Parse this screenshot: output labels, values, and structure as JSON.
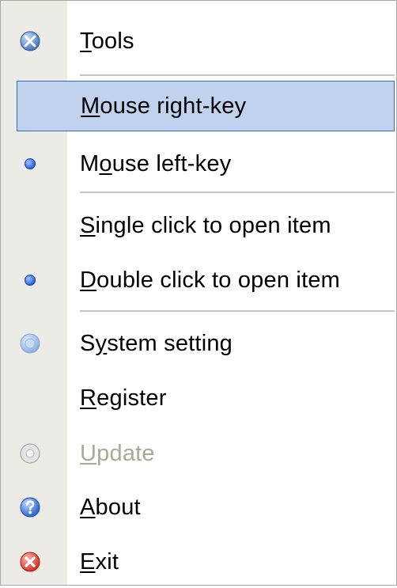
{
  "menu": {
    "colors": {
      "gutter": "#ecebe6",
      "highlight_bg": "#c1d2ee",
      "highlight_border": "#316ac5",
      "disabled_text": "#aca899"
    },
    "items": [
      {
        "pre": "",
        "acc": "T",
        "post": "ools",
        "icon": "tools-icon",
        "state": "normal"
      },
      {
        "pre": "",
        "acc": "M",
        "post": "ouse right-key",
        "icon": "",
        "state": "highlighted"
      },
      {
        "pre": "M",
        "acc": "o",
        "post": "use left-key",
        "icon": "radio-dot-icon",
        "state": "checked"
      },
      {
        "pre": "",
        "acc": "S",
        "post": "ingle click to open item",
        "icon": "",
        "state": "normal"
      },
      {
        "pre": "",
        "acc": "D",
        "post": "ouble click to open item",
        "icon": "radio-dot-icon",
        "state": "checked"
      },
      {
        "pre": "S",
        "acc": "y",
        "post": "stem setting",
        "icon": "system-setting-icon",
        "state": "normal"
      },
      {
        "pre": "",
        "acc": "R",
        "post": "egister",
        "icon": "",
        "state": "normal"
      },
      {
        "pre": "",
        "acc": "U",
        "post": "pdate",
        "icon": "update-icon",
        "state": "disabled"
      },
      {
        "pre": "",
        "acc": "A",
        "post": "bout",
        "icon": "help-icon",
        "state": "normal"
      },
      {
        "pre": "",
        "acc": "E",
        "post": "xit",
        "icon": "exit-icon",
        "state": "normal"
      }
    ]
  }
}
